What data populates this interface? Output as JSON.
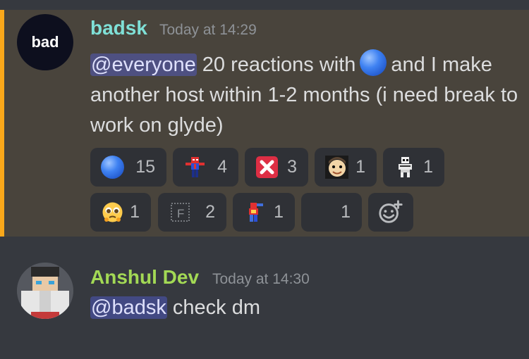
{
  "colors": {
    "background": "#36393f",
    "highlight_bg": "#49443c",
    "accent_bar": "#faa81a",
    "mention_bg": "#5865f2"
  },
  "message1": {
    "avatar_text": "bad",
    "author": "badsk",
    "author_color": "#7fe0d7",
    "timestamp": "Today at 14:29",
    "mention": "@everyone",
    "text_before_emoji": " 20 reactions with",
    "text_after_emoji": "and I make another host within 1-2 months (i need break to work on glyde)",
    "emoji_icon": "blue-circle-icon"
  },
  "reactions": [
    {
      "icon": "blue-circle-icon",
      "count": "15"
    },
    {
      "icon": "spiderman-pixel-icon",
      "count": "4"
    },
    {
      "icon": "red-x-icon",
      "count": "3"
    },
    {
      "icon": "face-meme-icon",
      "count": "1"
    },
    {
      "icon": "skeleton-pixel-icon",
      "count": "1"
    },
    {
      "icon": "pleading-face-icon",
      "count": "1"
    },
    {
      "icon": "letter-f-box-icon",
      "count": "2"
    },
    {
      "icon": "pixel-character-icon",
      "count": "1"
    },
    {
      "icon": "blank-emoji-icon",
      "count": "1"
    },
    {
      "icon": "add-reaction-icon",
      "count": ""
    }
  ],
  "message2": {
    "author": "Anshul Dev",
    "author_color": "#a3d955",
    "timestamp": "Today at 14:30",
    "mention": "@badsk",
    "text": " check dm",
    "avatar_icon": "pixel-avatar-icon"
  }
}
